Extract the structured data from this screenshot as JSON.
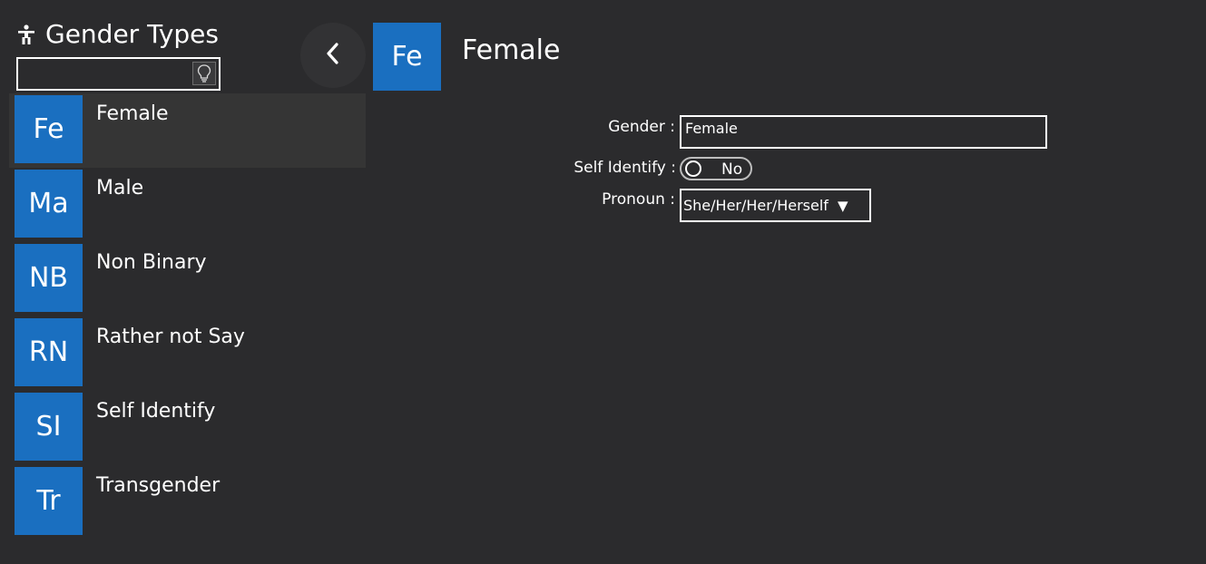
{
  "header": {
    "title": "Gender Types",
    "title_icon": "person-standing-icon"
  },
  "search": {
    "value": "",
    "placeholder": "",
    "hint_icon": "lightbulb-icon"
  },
  "list": {
    "items": [
      {
        "abbr": "Fe",
        "label": "Female",
        "selected": true
      },
      {
        "abbr": "Ma",
        "label": "Male",
        "selected": false
      },
      {
        "abbr": "NB",
        "label": "Non Binary",
        "selected": false
      },
      {
        "abbr": "RN",
        "label": "Rather not Say",
        "selected": false
      },
      {
        "abbr": "SI",
        "label": "Self Identify",
        "selected": false
      },
      {
        "abbr": "Tr",
        "label": "Transgender",
        "selected": false
      }
    ]
  },
  "nav": {
    "back_icon": "chevron-left-icon"
  },
  "detail": {
    "abbr": "Fe",
    "title": "Female",
    "gender_label": "Gender :",
    "gender_value": "Female",
    "self_identify_label": "Self Identify :",
    "self_identify_value": "No",
    "pronoun_label": "Pronoun :",
    "pronoun_value": "She/Her/Her/Herself",
    "pronoun_arrow": "▼"
  },
  "colors": {
    "background": "#2b2b2d",
    "accent": "#1a6fc0",
    "selected_row": "#353535"
  }
}
